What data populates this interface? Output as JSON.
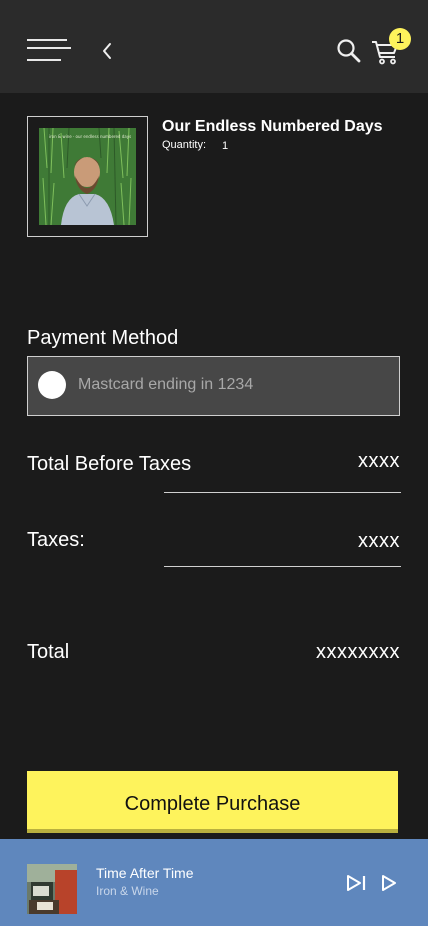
{
  "header": {
    "cart_count": "1",
    "menu_icon": "hamburger-menu-icon",
    "back_icon": "chevron-left-icon",
    "search_icon": "search-icon",
    "cart_icon": "shopping-cart-icon"
  },
  "product": {
    "title": "Our Endless Numbered Days",
    "quantity_label": "Quantity:",
    "quantity_value": "1"
  },
  "payment": {
    "label": "Payment Method",
    "selected_method": "Mastcard ending in 1234"
  },
  "totals": {
    "before_taxes_label": "Total Before Taxes",
    "before_taxes_value": "xxxx",
    "taxes_label": "Taxes:",
    "taxes_value": "xxxx",
    "total_label": "Total",
    "total_value": "xxxxxxxx"
  },
  "cta": {
    "complete_label": "Complete Purchase"
  },
  "player": {
    "track_title": "Time After Time",
    "track_artist": "Iron & Wine"
  },
  "colors": {
    "background": "#1b1b1b",
    "header": "#2b2b2b",
    "accent_yellow": "#fef35c",
    "player_blue": "#5f87bd",
    "field_gray": "#474747"
  }
}
